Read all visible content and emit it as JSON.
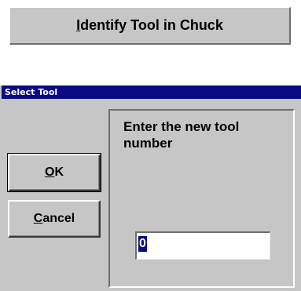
{
  "header_button": {
    "mnemonic": "I",
    "label_rest": "dentify Tool in Chuck"
  },
  "dialog": {
    "title": "Select Tool",
    "ok_button": {
      "mnemonic": "O",
      "rest": "K"
    },
    "cancel_button": {
      "mnemonic": "C",
      "rest": "ancel"
    },
    "prompt": "Enter the new tool number",
    "tool_number_value": "0"
  }
}
